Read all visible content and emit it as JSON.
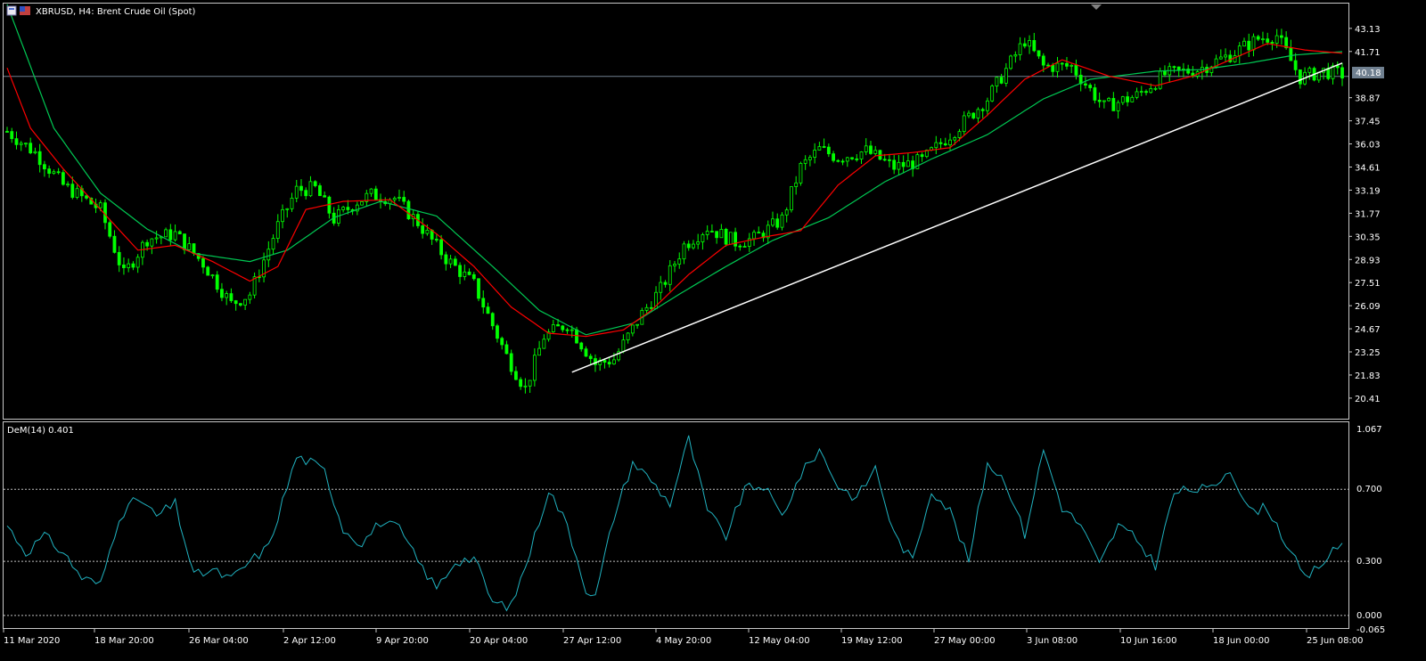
{
  "header": {
    "symbol_title": "XBRUSD, H4:  Brent Crude Oil (Spot)",
    "indicator_title": "DeM(14) 0.401"
  },
  "colors": {
    "background": "#000000",
    "frame": "#c8c8c8",
    "candle": "#00ff00",
    "ma_fast": "#ff0000",
    "ma_slow": "#00c853",
    "trendline": "#ffffff",
    "price_line": "#708090",
    "demarker": "#20b2c0",
    "level_lines": "#c0c0c0"
  },
  "chart_data": [
    {
      "type": "candlestick",
      "title": "XBRUSD, H4:  Brent Crude Oil (Spot)",
      "y_ticks": [
        "43.13",
        "41.71",
        "38.87",
        "37.45",
        "36.03",
        "34.61",
        "33.19",
        "31.77",
        "30.35",
        "28.93",
        "27.51",
        "26.09",
        "24.67",
        "23.25",
        "21.83",
        "20.41"
      ],
      "ylim": [
        19.2,
        44.6
      ],
      "current_price_label": "40.18",
      "current_price": 40.18,
      "x_ticks": [
        "11 Mar 2020",
        "18 Mar 20:00",
        "26 Mar 04:00",
        "2 Apr 12:00",
        "9 Apr 20:00",
        "20 Apr 04:00",
        "27 Apr 12:00",
        "4 May 20:00",
        "12 May 04:00",
        "19 May 12:00",
        "27 May 00:00",
        "3 Jun 08:00",
        "10 Jun 16:00",
        "18 Jun 00:00",
        "25 Jun 08:00"
      ],
      "close_path": [
        [
          0,
          36.8
        ],
        [
          6,
          35.5
        ],
        [
          12,
          33.5
        ],
        [
          20,
          32.0
        ],
        [
          25,
          28.0
        ],
        [
          30,
          30.2
        ],
        [
          36,
          30.5
        ],
        [
          42,
          28.7
        ],
        [
          48,
          26.2
        ],
        [
          52,
          26.8
        ],
        [
          58,
          31.0
        ],
        [
          62,
          33.2
        ],
        [
          66,
          33.3
        ],
        [
          70,
          31.4
        ],
        [
          75,
          32.5
        ],
        [
          78,
          32.9
        ],
        [
          83,
          32.7
        ],
        [
          88,
          31.2
        ],
        [
          94,
          29.0
        ],
        [
          100,
          27.4
        ],
        [
          107,
          23.0
        ],
        [
          111,
          21.0
        ],
        [
          115,
          24.2
        ],
        [
          120,
          25.0
        ],
        [
          126,
          22.5
        ],
        [
          130,
          22.8
        ],
        [
          136,
          25.6
        ],
        [
          140,
          27.1
        ],
        [
          145,
          29.8
        ],
        [
          150,
          30.9
        ],
        [
          156,
          30.0
        ],
        [
          160,
          30.2
        ],
        [
          166,
          31.4
        ],
        [
          170,
          34.6
        ],
        [
          174,
          35.7
        ],
        [
          178,
          35.2
        ],
        [
          184,
          35.6
        ],
        [
          190,
          34.6
        ],
        [
          196,
          35.0
        ],
        [
          205,
          37.4
        ],
        [
          210,
          38.8
        ],
        [
          218,
          42.4
        ],
        [
          222,
          40.8
        ],
        [
          228,
          40.8
        ],
        [
          235,
          38.3
        ],
        [
          242,
          39.0
        ],
        [
          248,
          40.3
        ],
        [
          255,
          40.6
        ],
        [
          262,
          41.5
        ],
        [
          268,
          42.5
        ],
        [
          272,
          42.7
        ],
        [
          277,
          40.1
        ],
        [
          282,
          40.5
        ],
        [
          286,
          40.3
        ]
      ],
      "ma_fast_path": [
        [
          0,
          40.7
        ],
        [
          5,
          37.0
        ],
        [
          12,
          34.5
        ],
        [
          20,
          32.0
        ],
        [
          28,
          29.5
        ],
        [
          36,
          29.8
        ],
        [
          44,
          28.8
        ],
        [
          52,
          27.6
        ],
        [
          58,
          28.5
        ],
        [
          64,
          32.0
        ],
        [
          72,
          32.5
        ],
        [
          82,
          32.6
        ],
        [
          92,
          30.5
        ],
        [
          100,
          28.5
        ],
        [
          108,
          26.0
        ],
        [
          116,
          24.4
        ],
        [
          124,
          24.2
        ],
        [
          132,
          24.6
        ],
        [
          138,
          25.8
        ],
        [
          146,
          28.0
        ],
        [
          154,
          29.8
        ],
        [
          162,
          30.3
        ],
        [
          170,
          30.7
        ],
        [
          178,
          33.5
        ],
        [
          186,
          35.3
        ],
        [
          194,
          35.5
        ],
        [
          202,
          35.8
        ],
        [
          210,
          37.8
        ],
        [
          218,
          40.0
        ],
        [
          226,
          41.2
        ],
        [
          236,
          40.2
        ],
        [
          246,
          39.6
        ],
        [
          254,
          40.2
        ],
        [
          262,
          41.2
        ],
        [
          270,
          42.2
        ],
        [
          278,
          41.8
        ],
        [
          286,
          41.6
        ]
      ],
      "ma_slow_path": [
        [
          0,
          44.6
        ],
        [
          10,
          37.0
        ],
        [
          20,
          33.0
        ],
        [
          30,
          30.8
        ],
        [
          40,
          29.3
        ],
        [
          52,
          28.8
        ],
        [
          60,
          29.5
        ],
        [
          70,
          31.5
        ],
        [
          80,
          32.5
        ],
        [
          92,
          31.6
        ],
        [
          104,
          28.5
        ],
        [
          114,
          25.8
        ],
        [
          124,
          24.3
        ],
        [
          134,
          25.0
        ],
        [
          144,
          26.8
        ],
        [
          154,
          28.5
        ],
        [
          164,
          30.1
        ],
        [
          176,
          31.5
        ],
        [
          188,
          33.7
        ],
        [
          198,
          35.1
        ],
        [
          210,
          36.6
        ],
        [
          222,
          38.8
        ],
        [
          232,
          40.0
        ],
        [
          246,
          40.5
        ],
        [
          256,
          40.6
        ],
        [
          266,
          41.0
        ],
        [
          276,
          41.5
        ],
        [
          286,
          41.7
        ]
      ],
      "trendline": [
        [
          121,
          22.0
        ],
        [
          286,
          41.0
        ]
      ]
    },
    {
      "type": "line",
      "title": "DeM(14) 0.401",
      "y_ticks": [
        "1.067",
        "0.700",
        "0.300",
        "0.000",
        "-0.065"
      ],
      "ylim": [
        -0.065,
        1.067
      ],
      "levels": [
        0.7,
        0.3,
        0.0
      ],
      "last_value": 0.401,
      "path": [
        [
          0,
          0.5
        ],
        [
          4,
          0.35
        ],
        [
          8,
          0.44
        ],
        [
          12,
          0.35
        ],
        [
          16,
          0.21
        ],
        [
          20,
          0.17
        ],
        [
          24,
          0.55
        ],
        [
          28,
          0.65
        ],
        [
          32,
          0.55
        ],
        [
          36,
          0.62
        ],
        [
          40,
          0.22
        ],
        [
          44,
          0.25
        ],
        [
          48,
          0.2
        ],
        [
          52,
          0.3
        ],
        [
          56,
          0.38
        ],
        [
          58,
          0.55
        ],
        [
          62,
          0.88
        ],
        [
          65,
          0.85
        ],
        [
          68,
          0.8
        ],
        [
          72,
          0.48
        ],
        [
          76,
          0.4
        ],
        [
          80,
          0.52
        ],
        [
          84,
          0.48
        ],
        [
          88,
          0.3
        ],
        [
          92,
          0.15
        ],
        [
          96,
          0.3
        ],
        [
          100,
          0.32
        ],
        [
          104,
          0.07
        ],
        [
          108,
          0.05
        ],
        [
          112,
          0.35
        ],
        [
          116,
          0.7
        ],
        [
          120,
          0.5
        ],
        [
          124,
          0.15
        ],
        [
          126,
          0.1
        ],
        [
          130,
          0.55
        ],
        [
          134,
          0.85
        ],
        [
          138,
          0.75
        ],
        [
          142,
          0.62
        ],
        [
          146,
          0.98
        ],
        [
          150,
          0.58
        ],
        [
          154,
          0.44
        ],
        [
          158,
          0.7
        ],
        [
          162,
          0.72
        ],
        [
          166,
          0.55
        ],
        [
          170,
          0.78
        ],
        [
          174,
          0.92
        ],
        [
          178,
          0.72
        ],
        [
          182,
          0.65
        ],
        [
          186,
          0.82
        ],
        [
          190,
          0.45
        ],
        [
          194,
          0.3
        ],
        [
          198,
          0.7
        ],
        [
          202,
          0.58
        ],
        [
          206,
          0.3
        ],
        [
          210,
          0.85
        ],
        [
          214,
          0.74
        ],
        [
          218,
          0.45
        ],
        [
          222,
          0.92
        ],
        [
          226,
          0.6
        ],
        [
          230,
          0.5
        ],
        [
          234,
          0.28
        ],
        [
          238,
          0.5
        ],
        [
          242,
          0.42
        ],
        [
          246,
          0.28
        ],
        [
          250,
          0.68
        ],
        [
          254,
          0.7
        ],
        [
          258,
          0.7
        ],
        [
          262,
          0.82
        ],
        [
          266,
          0.58
        ],
        [
          270,
          0.6
        ],
        [
          274,
          0.4
        ],
        [
          278,
          0.2
        ],
        [
          282,
          0.3
        ],
        [
          286,
          0.401
        ]
      ]
    }
  ]
}
